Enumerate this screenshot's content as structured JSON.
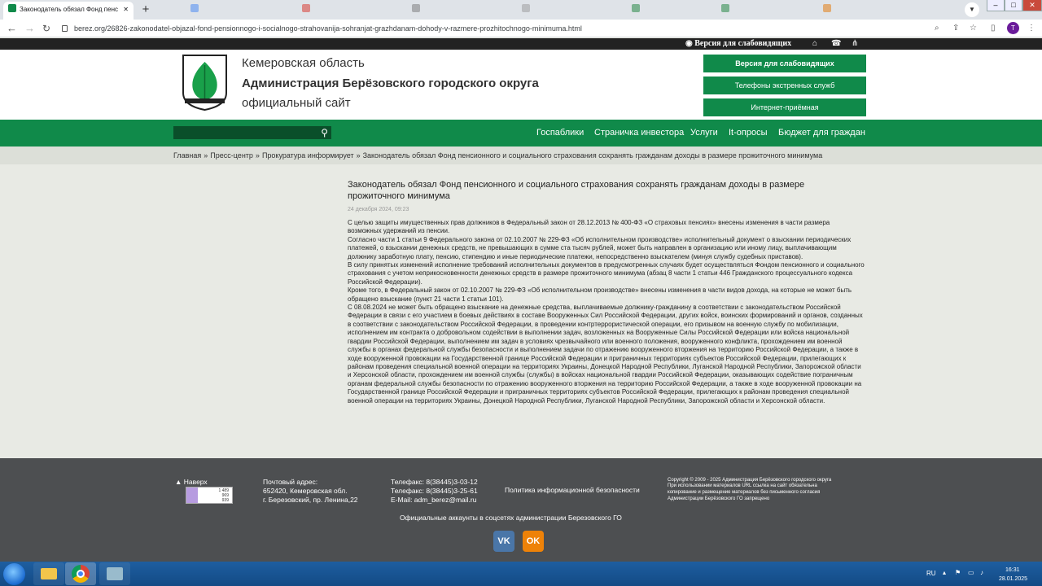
{
  "browser": {
    "active_tab_title": "Законодатель обязал Фонд пенс",
    "url": "berez.org/26826-zakonodatel-objazal-fond-pensionnogo-i-socialnogo-strahovanija-sohranjat-grazhdanam-dohody-v-razmere-prozhitochnogo-minimuma.html",
    "profile_initial": "T"
  },
  "strip": {
    "vision_label": "Версия для слабовидящих"
  },
  "header": {
    "region": "Кемеровская область",
    "admin": "Администрация Берёзовского городского округа",
    "official": "официальный сайт",
    "buttons": [
      "Версия для слабовидящих",
      "Телефоны экстренных служб",
      "Интернет-приёмная"
    ]
  },
  "nav": {
    "items": [
      "Госпаблики",
      "Страничка инвестора",
      "Услуги",
      "It-опросы",
      "Бюджет для граждан"
    ]
  },
  "breadcrumbs": [
    "Главная",
    "Пресс-центр",
    "Прокуратура информирует",
    "Законодатель обязал Фонд пенсионного и социального страхования сохранять гражданам доходы в размере прожиточного минимума"
  ],
  "article": {
    "title": "Законодатель обязал Фонд пенсионного и социального страхования сохранять гражданам доходы в размере прожиточного минимума",
    "date": "24 декабря 2024, 09:23",
    "paragraphs": [
      "С целью защиты имущественных прав должников в Федеральный закон от 28.12.2013 № 400-ФЗ «О страховых пенсиях» внесены изменения в части размера возможных удержаний из пенсии.",
      "Согласно части 1 статьи 9 Федерального закона от 02.10.2007 № 229-ФЗ «Об исполнительном производстве» исполнительный документ о взыскании периодических платежей, о взыскании денежных средств, не превышающих в сумме ста тысяч рублей, может быть направлен в организацию или иному лицу, выплачивающим должнику заработную плату, пенсию, стипендию и иные периодические платежи, непосредственно взыскателем (минуя службу судебных приставов).",
      "В силу принятых изменений исполнение требований исполнительных документов в предусмотренных случаях будет осуществляться Фондом пенсионного и социального страхования с учетом неприкосновенности денежных средств в размере прожиточного минимума (абзац 8 части 1 статьи 446 Гражданского процессуального кодекса Российской Федерации).",
      "Кроме того, в Федеральный закон от 02.10.2007 № 229-ФЗ «Об исполнительном производстве» внесены изменения в части видов дохода, на которые не может быть обращено взыскание (пункт 21 части 1 статьи 101).",
      "С 08.08.2024 не может быть обращено взыскание на денежные средства, выплачиваемые должнику-гражданину в соответствии с законодательством Российской Федерации в связи с его участием в боевых действиях в составе Вооруженных Сил Российской Федерации, других войск, воинских формирований и органов, созданных в соответствии с законодательством Российской Федерации, в проведении контртеррористической операции, его призывом на военную службу по мобилизации, исполнением им контракта о добровольном содействии в выполнении задач, возложенных на Вооруженные Силы Российской Федерации или войска национальной гвардии Российской Федерации, выполнением им задач в условиях чрезвычайного или военного положения, вооруженного конфликта, прохождением им военной службы в органах федеральной службы безопасности и выполнением задачи по отражению вооруженного вторжения на территорию Российской Федерации, а также в ходе вооруженной провокации на Государственной границе Российской Федерации и приграничных территориях субъектов Российской Федерации, прилегающих к районам проведения специальной военной операции на территориях Украины, Донецкой Народной Республики, Луганской Народной Республики, Запорожской области и Херсонской области, прохождением им военной службы (службы) в войсках национальной гвардии Российской Федерации, оказывающих содействие пограничным органам федеральной службы безопасности по отражению вооруженного вторжения на территорию Российской Федерации, а также в ходе вооруженной провокации на Государственной границе Российской Федерации и приграничных территориях субъектов Российской Федерации, прилегающих к районам проведения специальной военной операции на территориях Украины, Донецкой Народной Республики, Луганской Народной Республики, Запорожской области и Херсонской области."
    ]
  },
  "footer": {
    "top_link": "Наверх",
    "counter": [
      "1 489",
      "969",
      "939"
    ],
    "address_label": "Почтовый адрес:",
    "address_line1": "652420, Кемеровская обл.",
    "address_line2": "г. Березовский, пр. Ленина,22",
    "phone1": "Телефакс: 8(38445)3-03-12",
    "phone2": "Телефакс: 8(38445)3-25-61",
    "email": "E-Mail: adm_berez@mail.ru",
    "policy": "Политика информационной безопасности",
    "copyright": [
      "Copyright © 2009 - 2025 Администрация Берёзовского городского округа",
      "При использовании материалов URL ссылка на сайт обязательна",
      "копирование и размещение материалов без письменного согласия",
      "Администрации Берёзовского ГО запрещено"
    ],
    "social_caption": "Официальные аккаунты в соцсетях администрации Березовского ГО",
    "vk": "VK",
    "ok": "OK"
  },
  "taskbar": {
    "lang": "RU",
    "time": "16:31",
    "date": "28.01.2025"
  },
  "colors": {
    "green": "#108a4a",
    "dark_green": "#0a4f2a",
    "footer": "#4d4f51"
  }
}
